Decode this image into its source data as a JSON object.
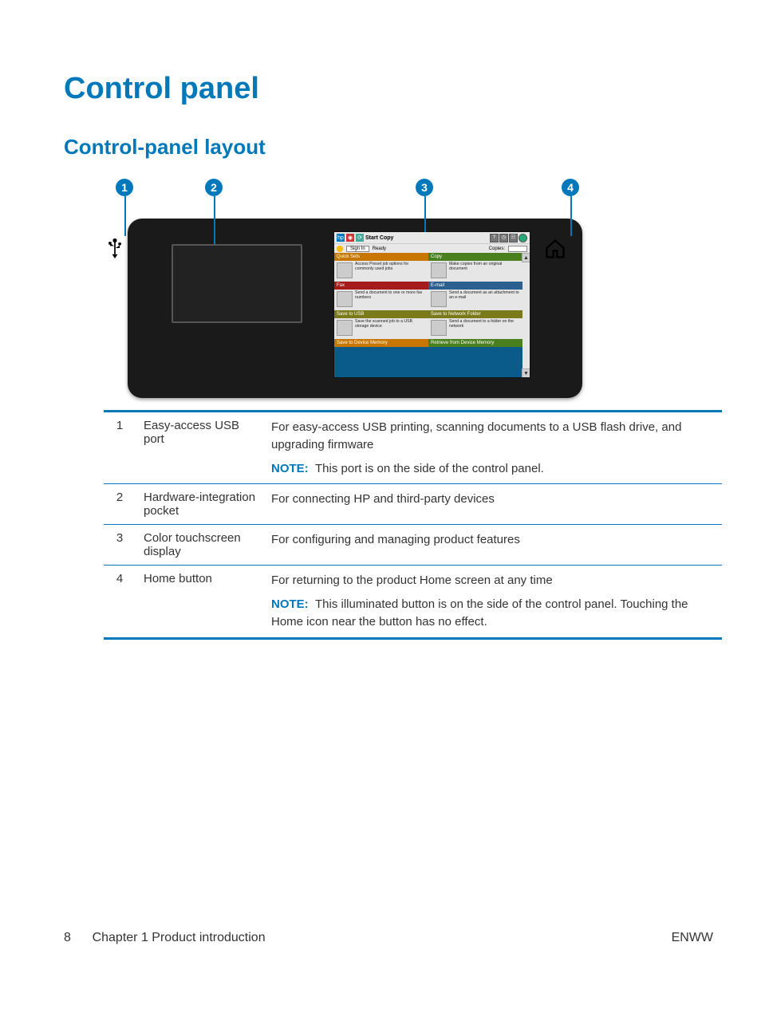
{
  "title": "Control panel",
  "subtitle": "Control-panel layout",
  "callouts": [
    {
      "num": "1",
      "name": "Easy-access USB port",
      "desc": "For easy-access USB printing, scanning documents to a USB flash drive, and upgrading firmware",
      "note": "This port is on the side of the control panel."
    },
    {
      "num": "2",
      "name": "Hardware-integration pocket",
      "desc": "For connecting HP and third-party devices",
      "note": ""
    },
    {
      "num": "3",
      "name": "Color touchscreen display",
      "desc": "For configuring and managing product features",
      "note": ""
    },
    {
      "num": "4",
      "name": "Home button",
      "desc": "For returning to the product Home screen at any time",
      "note": "This illuminated button is on the side of the control panel. Touching the Home icon near the button has no effect."
    }
  ],
  "note_label": "NOTE:",
  "touchscreen": {
    "title": "Start Copy",
    "sign_in": "Sign In",
    "ready": "Ready",
    "copies": "Copies:",
    "tiles_left": [
      {
        "hdr": "Quick Sets",
        "cls": "hdr-orange",
        "text": "Access Preset job options for commonly used jobs"
      },
      {
        "hdr": "Fax",
        "cls": "hdr-red",
        "text": "Send a document to one or more fax numbers"
      },
      {
        "hdr": "Save to USB",
        "cls": "hdr-olive",
        "text": "Save the scanned job to a USB storage device"
      },
      {
        "hdr": "Save to Device Memory",
        "cls": "hdr-orange",
        "text": ""
      }
    ],
    "tiles_right": [
      {
        "hdr": "Copy",
        "cls": "hdr-green",
        "text": "Make copies from an original document"
      },
      {
        "hdr": "E-mail",
        "cls": "hdr-blue",
        "text": "Send a document as an attachment to an e-mail"
      },
      {
        "hdr": "Save to Network Folder",
        "cls": "hdr-olive",
        "text": "Send a document to a folder on the network"
      },
      {
        "hdr": "Retrieve from Device Memory",
        "cls": "hdr-green",
        "text": ""
      }
    ]
  },
  "footer": {
    "page": "8",
    "chapter": "Chapter 1   Product introduction",
    "lang": "ENWW"
  }
}
